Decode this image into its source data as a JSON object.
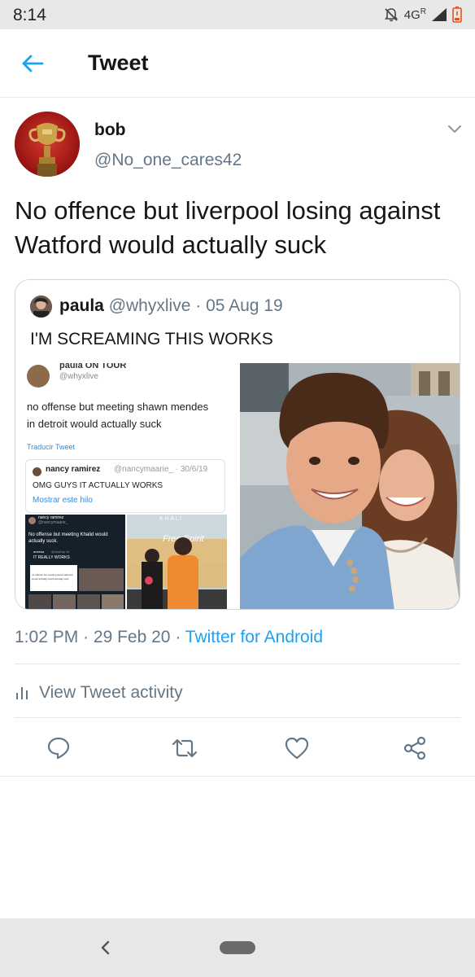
{
  "status_bar": {
    "time": "8:14",
    "network": "4G",
    "network_sup": "R",
    "icons": [
      "mute-bell-icon",
      "signal-icon",
      "battery-low-icon"
    ]
  },
  "app_bar": {
    "title": "Tweet",
    "back_icon": "arrow-left-icon"
  },
  "tweet": {
    "author_name": "bob",
    "author_handle": "@No_one_cares42",
    "text": "No offence but liverpool losing against Watford would actually suck",
    "timestamp": "1:02 PM",
    "date": "29 Feb 20",
    "source": "Twitter for Android",
    "separator": "·"
  },
  "quoted_tweet": {
    "name": "paula",
    "handle": "@whyxlive",
    "date": "05 Aug 19",
    "text": "I'M SCREAMING THIS WORKS",
    "screenshot": {
      "user_name": "paula ON TOUR",
      "user_handle": "@whyxlive",
      "text_line1": "no offense but meeting shawn mendes",
      "text_line2": "in detroit would actually suck",
      "translate": "Traducir Tweet",
      "inner_name": "nancy ramirez",
      "inner_meta": "@nancymaarie_ · 30/6/19",
      "inner_text": "OMG GUYS IT ACTUALLY WORKS",
      "inner_thread": "Mostrar este hilo",
      "mini_user": "nancy ramirez",
      "mini_handle": "@nancymaarie_",
      "mini_text_line1": "No offense but meeting Khalid would",
      "mini_text_line2": "actually suck.",
      "mini_reply_name": "aneesa",
      "mini_reply_handle": "@zeyfray 4d",
      "mini_reply_text": "IT REALLY WORKS",
      "mini_tiny_line1": "no offense but meeting jacob sartorius",
      "mini_tiny_line2": "would actually would actually suck",
      "poster_text_1": "K H A L I",
      "poster_text_2": "Free Spirit"
    }
  },
  "activity": {
    "label": "View Tweet activity",
    "icon": "bar-chart-icon"
  },
  "actions": [
    {
      "name": "reply",
      "icon": "reply-bubble-icon"
    },
    {
      "name": "retweet",
      "icon": "retweet-icon"
    },
    {
      "name": "like",
      "icon": "heart-outline-icon"
    },
    {
      "name": "share",
      "icon": "share-icon"
    }
  ],
  "colors": {
    "link_blue": "#1da1f2",
    "secondary_text": "#657786",
    "primary_text": "#14171a",
    "divider": "#e1e8ed",
    "system_bar": "#e8e8e8"
  }
}
